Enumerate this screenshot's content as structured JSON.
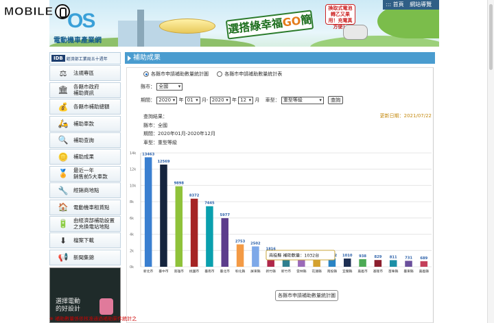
{
  "watermark": {
    "text": "MOBILE",
    "logo_icon": "mobile01-icon"
  },
  "banner": {
    "site_logo": "OS",
    "site_title": "電動機車產業網",
    "slogan_a": "選搭綠幸福",
    "slogan_go": "GO",
    "slogan_b": "簡單",
    "promo": "換取式電池 \n轉乙又果用！充電真方便！",
    "top_links": [
      "::: 首頁",
      "網站導覽"
    ]
  },
  "sidebar": {
    "org_badge": "IDB",
    "org_name": "經濟部工業局五十週年",
    "items": [
      {
        "label": "法規專區",
        "icon": "gavel-icon",
        "glyph": "⚖"
      },
      {
        "label": "各縣市政府\n補助資訊",
        "icon": "government-building-icon",
        "glyph": "🏛"
      },
      {
        "label": "各縣市補助總額",
        "icon": "money-bag-icon",
        "glyph": "💰"
      },
      {
        "label": "補助車款",
        "icon": "scooter-icon",
        "glyph": "🛵"
      },
      {
        "label": "補助查詢",
        "icon": "magnifier-icon",
        "glyph": "🔍"
      },
      {
        "label": "補助成果",
        "icon": "coins-icon",
        "glyph": "🪙"
      },
      {
        "label": "最近一年\n銷售前5大車款",
        "icon": "ribbon-medal-icon",
        "glyph": "🏅"
      },
      {
        "label": "經銷商地點",
        "icon": "tools-icon",
        "glyph": "🔧"
      },
      {
        "label": "電動機車租賃點",
        "icon": "house-icon",
        "glyph": "🏠"
      },
      {
        "label": "由經濟部補助設置\n之充換電站地點",
        "icon": "battery-icon",
        "glyph": "🔋"
      },
      {
        "label": "檔案下載",
        "icon": "download-icon",
        "glyph": "⬇"
      },
      {
        "label": "新聞集錦",
        "icon": "megaphone-icon",
        "glyph": "📢"
      }
    ],
    "bottom_text": "選擇電動\n的好設計"
  },
  "content": {
    "header": "補助成果",
    "radio_options": [
      {
        "label": "各縣市申請補助數量統計圖",
        "checked": true
      },
      {
        "label": "各縣市申請補助數量統計表",
        "checked": false
      }
    ],
    "county_label": "縣市：",
    "county_value": "全國",
    "period_label": "期間：",
    "year_start": "2020",
    "year_start_suffix": "年",
    "month_start": "01",
    "month_start_suffix": "月-",
    "year_end": "2020",
    "year_end_suffix": "年",
    "month_end": "12",
    "month_end_suffix": "月",
    "vehicle_label": "車型：",
    "vehicle_value": "重型等級",
    "query_button": "查詢",
    "update_date": "更新日期：2021/07/22",
    "results": {
      "heading": "查詢結果：",
      "county": "縣市：全國",
      "period": "期間：2020年01月-2020年12月",
      "vehicle": "車型：重型等級"
    },
    "toggle_button": "各縣市申請補助數量統計圖",
    "footer_note": "※ 補助數量係依核准通過補助案件統計之"
  },
  "chart_data": {
    "type": "bar",
    "categories": [
      "新北市",
      "臺中市",
      "高雄市",
      "桃園市",
      "臺南市",
      "臺北市",
      "彰化縣",
      "屏東縣",
      "新竹縣",
      "新竹市",
      "雲林縣",
      "花蓮縣",
      "南投縣",
      "宜蘭縣",
      "嘉義市",
      "基隆市",
      "苗栗縣",
      "臺東縣",
      "嘉義縣"
    ],
    "values": [
      13463,
      12569,
      9898,
      8372,
      7445,
      5977,
      2753,
      2502,
      1816,
      1496,
      1424,
      1032,
      1032,
      1010,
      938,
      829,
      811,
      731,
      689
    ],
    "colors": [
      "#3a7fd0",
      "#15243e",
      "#8fc23a",
      "#a52424",
      "#0aa0ae",
      "#5c3d8c",
      "#f39a45",
      "#7da8e8",
      "#b0284a",
      "#2f7f8f",
      "#9b6ab8",
      "#d4a12e",
      "#2a84c4",
      "#1d2f52",
      "#4caa55",
      "#8c1f2e",
      "#1b8fa6",
      "#6a4f9c",
      "#c4405a"
    ],
    "ylim": [
      0,
      14000
    ],
    "ytick_labels": [
      "0k",
      "2k",
      "4k",
      "6k",
      "8k",
      "10k",
      "12k",
      "14k"
    ],
    "tooltip": "南投縣 補助數量：1032台",
    "grid": true
  }
}
